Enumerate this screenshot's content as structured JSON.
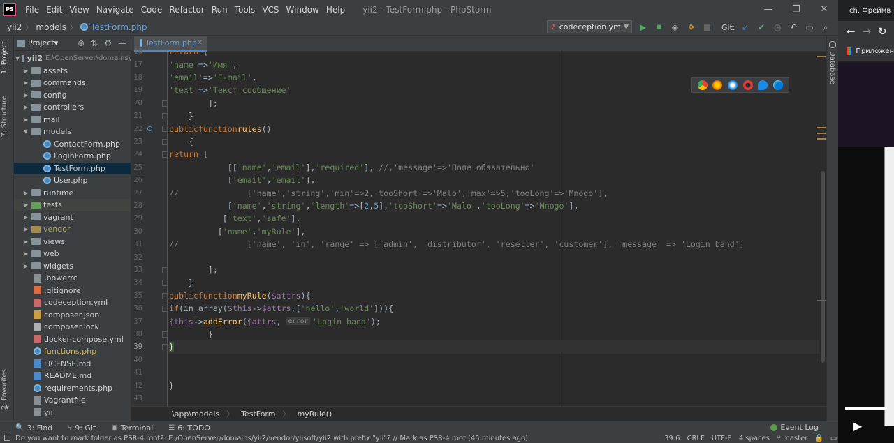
{
  "window": {
    "logo": "PS",
    "title": "yii2 - TestForm.php - PhpStorm",
    "menu": [
      "File",
      "Edit",
      "View",
      "Navigate",
      "Code",
      "Refactor",
      "Run",
      "Tools",
      "VCS",
      "Window",
      "Help"
    ],
    "controls": [
      "—",
      "❐",
      "✕"
    ]
  },
  "navbar": {
    "crumbs": [
      "yii2",
      "models",
      "TestForm.php"
    ],
    "run_config": "codeception.yml",
    "git_label": "Git:"
  },
  "left_stripe": {
    "project": "1: Project",
    "structure": "7: Structure",
    "favorites": "2: Favorites"
  },
  "right_stripe": {
    "database": "Database"
  },
  "project_panel": {
    "title": "Project▾",
    "root": "yii2",
    "root_path": "E:\\OpenServer\\domains\\",
    "items": [
      {
        "label": "assets",
        "type": "folder"
      },
      {
        "label": "commands",
        "type": "folder"
      },
      {
        "label": "config",
        "type": "folder"
      },
      {
        "label": "controllers",
        "type": "folder"
      },
      {
        "label": "mail",
        "type": "folder"
      },
      {
        "label": "models",
        "type": "folder-open"
      },
      {
        "label": "ContactForm.php",
        "type": "php"
      },
      {
        "label": "LoginForm.php",
        "type": "php"
      },
      {
        "label": "TestForm.php",
        "type": "php"
      },
      {
        "label": "User.php",
        "type": "php"
      },
      {
        "label": "runtime",
        "type": "folder"
      },
      {
        "label": "tests",
        "type": "folder-green"
      },
      {
        "label": "vagrant",
        "type": "folder"
      },
      {
        "label": "vendor",
        "type": "folder-orange"
      },
      {
        "label": "views",
        "type": "folder"
      },
      {
        "label": "web",
        "type": "folder"
      },
      {
        "label": "widgets",
        "type": "folder"
      },
      {
        "label": ".bowerrc",
        "type": "file"
      },
      {
        "label": ".gitignore",
        "type": "git"
      },
      {
        "label": "codeception.yml",
        "type": "yml"
      },
      {
        "label": "composer.json",
        "type": "json"
      },
      {
        "label": "composer.lock",
        "type": "lock"
      },
      {
        "label": "docker-compose.yml",
        "type": "yml"
      },
      {
        "label": "functions.php",
        "type": "php"
      },
      {
        "label": "LICENSE.md",
        "type": "md"
      },
      {
        "label": "README.md",
        "type": "md"
      },
      {
        "label": "requirements.php",
        "type": "php"
      },
      {
        "label": "Vagrantfile",
        "type": "file"
      },
      {
        "label": "yii",
        "type": "file"
      }
    ]
  },
  "editor": {
    "tab": "TestForm.php",
    "current_line": 39,
    "lines": [
      {
        "n": 16,
        "code": "        return ["
      },
      {
        "n": 17,
        "code": "            'name'=>'Имя',"
      },
      {
        "n": 18,
        "code": "            'email'=>'E-mail',"
      },
      {
        "n": 19,
        "code": "            'text'=>'Текст сообщение'"
      },
      {
        "n": 20,
        "code": "        ];"
      },
      {
        "n": 21,
        "code": "    }"
      },
      {
        "n": 22,
        "code": "    public function rules()"
      },
      {
        "n": 23,
        "code": "    {"
      },
      {
        "n": 24,
        "code": "        return ["
      },
      {
        "n": 25,
        "code": "            [['name','email'],'required'], //,'message'=>'Поле обязательно'"
      },
      {
        "n": 26,
        "code": "            ['email','email'],"
      },
      {
        "n": 27,
        "code": "//              ['name','string','min'=>2,'tooShort'=>'Malo','max'=>5,'tooLong'=>'Mnogo'],"
      },
      {
        "n": 28,
        "code": "            ['name','string','length'=>[2,5],'tooShort'=>'Malo','tooLong'=>'Mnogo'],"
      },
      {
        "n": 29,
        "code": "           ['text','safe'],"
      },
      {
        "n": 30,
        "code": "          ['name','myRule'],"
      },
      {
        "n": 31,
        "code": "//              ['name', 'in', 'range' => ['admin', 'distributor', 'reseller', 'customer'], 'message' => 'Login band']"
      },
      {
        "n": 32,
        "code": ""
      },
      {
        "n": 33,
        "code": "        ];"
      },
      {
        "n": 34,
        "code": "    }"
      },
      {
        "n": 35,
        "code": "    public function myRule($attrs){"
      },
      {
        "n": 36,
        "code": "        if(in_array($this->$attrs,['hello','world'])){"
      },
      {
        "n": 37,
        "code": "            $this->addError($attrs, error: 'Login band');"
      },
      {
        "n": 38,
        "code": "        }"
      },
      {
        "n": 39,
        "code": "    }"
      },
      {
        "n": 40,
        "code": ""
      },
      {
        "n": 41,
        "code": ""
      },
      {
        "n": 42,
        "code": "}"
      },
      {
        "n": 43,
        "code": ""
      }
    ],
    "param_hint": "error:",
    "breadcrumb": [
      "\\app\\models",
      "TestForm",
      "myRule()"
    ]
  },
  "tool_windows": [
    {
      "label": "3: Find",
      "icon": "🔍"
    },
    {
      "label": "9: Git",
      "icon": "⑂"
    },
    {
      "label": "Terminal",
      "icon": "▣"
    },
    {
      "label": "6: TODO",
      "icon": "☰"
    }
  ],
  "event_log": "Event Log",
  "status": {
    "message": "Do you want to mark folder as PSR-4 root?: E:/OpenServer/domains/yii2/vendor/yiisoft/yii2 with prefix \"yii\"? // Mark as PSR-4 root (45 minutes ago)",
    "position": "39:6",
    "line_sep": "CRLF",
    "encoding": "UTF-8",
    "indent": "4 spaces",
    "branch": "master"
  },
  "side_browser": {
    "tab_text": "ch.  Фреймв",
    "bookmarks_text": "Приложен"
  },
  "colors": {
    "keyword": "#cc7832",
    "function": "#ffc66d",
    "string": "#6a8759",
    "number": "#6897bb",
    "variable": "#9876aa",
    "comment": "#808080",
    "accent": "#4a88c7"
  }
}
